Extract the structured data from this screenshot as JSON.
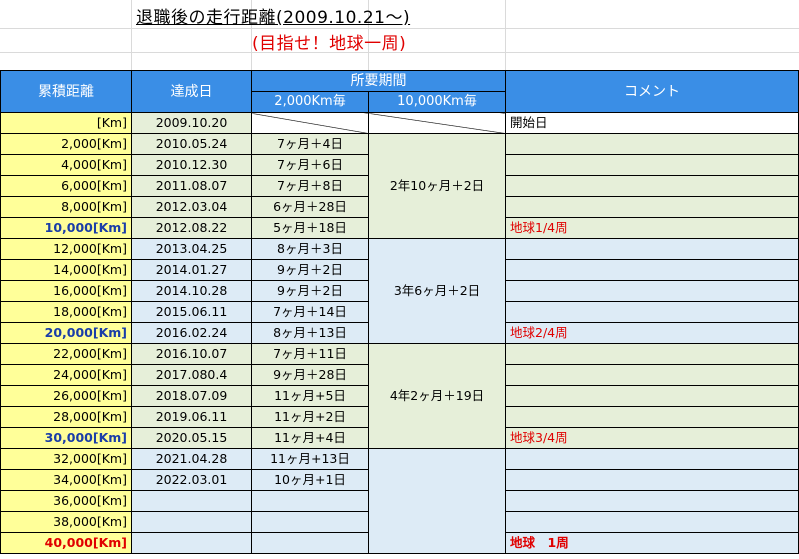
{
  "title": "退職後の走行距離(2009.10.21～)",
  "subtitle": "(目指せ！地球一周)",
  "headers": {
    "distance": "累積距離",
    "date": "達成日",
    "period": "所要期間",
    "per2000": "2,000Km毎",
    "per10000": "10,000Km毎",
    "comment": "コメント"
  },
  "rows": [
    {
      "dist": "[Km]",
      "date": "2009.10.20",
      "dur": "",
      "comment": "開始日"
    },
    {
      "dist": "2,000[Km]",
      "date": "2010.05.24",
      "dur": "7ヶ月＋4日",
      "comment": ""
    },
    {
      "dist": "4,000[Km]",
      "date": "2010.12.30",
      "dur": "7ヶ月＋6日",
      "comment": ""
    },
    {
      "dist": "6,000[Km]",
      "date": "2011.08.07",
      "dur": "7ヶ月＋8日",
      "comment": ""
    },
    {
      "dist": "8,000[Km]",
      "date": "2012.03.04",
      "dur": "6ヶ月＋28日",
      "comment": ""
    },
    {
      "dist": "10,000[Km]",
      "date": "2012.08.22",
      "dur": "5ヶ月＋18日",
      "comment": "地球1/4周"
    },
    {
      "dist": "12,000[Km]",
      "date": "2013.04.25",
      "dur": "8ヶ月＋3日",
      "comment": ""
    },
    {
      "dist": "14,000[Km]",
      "date": "2014.01.27",
      "dur": "9ヶ月＋2日",
      "comment": ""
    },
    {
      "dist": "16,000[Km]",
      "date": "2014.10.28",
      "dur": "9ヶ月＋2日",
      "comment": ""
    },
    {
      "dist": "18,000[Km]",
      "date": "2015.06.11",
      "dur": "7ヶ月＋14日",
      "comment": ""
    },
    {
      "dist": "20,000[Km]",
      "date": "2016.02.24",
      "dur": "8ヶ月＋13日",
      "comment": "地球2/4周"
    },
    {
      "dist": "22,000[Km]",
      "date": "2016.10.07",
      "dur": "7ヶ月＋11日",
      "comment": ""
    },
    {
      "dist": "24,000[Km]",
      "date": "2017.080.4",
      "dur": "9ヶ月＋28日",
      "comment": ""
    },
    {
      "dist": "26,000[Km]",
      "date": "2018.07.09",
      "dur": "11ヶ月+5日",
      "comment": ""
    },
    {
      "dist": "28,000[Km]",
      "date": "2019.06.11",
      "dur": "11ヶ月+2日",
      "comment": ""
    },
    {
      "dist": "30,000[Km]",
      "date": "2020.05.15",
      "dur": "11ヶ月+4日",
      "comment": "地球3/4周"
    },
    {
      "dist": "32,000[Km]",
      "date": "2021.04.28",
      "dur": "11ヶ月+13日",
      "comment": ""
    },
    {
      "dist": "34,000[Km]",
      "date": "2022.03.01",
      "dur": "10ヶ月+1日",
      "comment": ""
    },
    {
      "dist": "36,000[Km]",
      "date": "",
      "dur": "",
      "comment": ""
    },
    {
      "dist": "38,000[Km]",
      "date": "",
      "dur": "",
      "comment": ""
    },
    {
      "dist": "40,000[Km]",
      "date": "",
      "dur": "",
      "comment": "地球　1周"
    }
  ],
  "periods": [
    "2年10ヶ月＋2日",
    "3年6ヶ月＋2日",
    "4年2ヶ月＋19日"
  ],
  "colors": {
    "header": "#3a8ee6",
    "distance_fill": "#ffff99",
    "green_fill": "#e6efd9",
    "blue_fill": "#ddebf6",
    "red_text": "#e00000",
    "blue_text": "#1a3da8"
  }
}
